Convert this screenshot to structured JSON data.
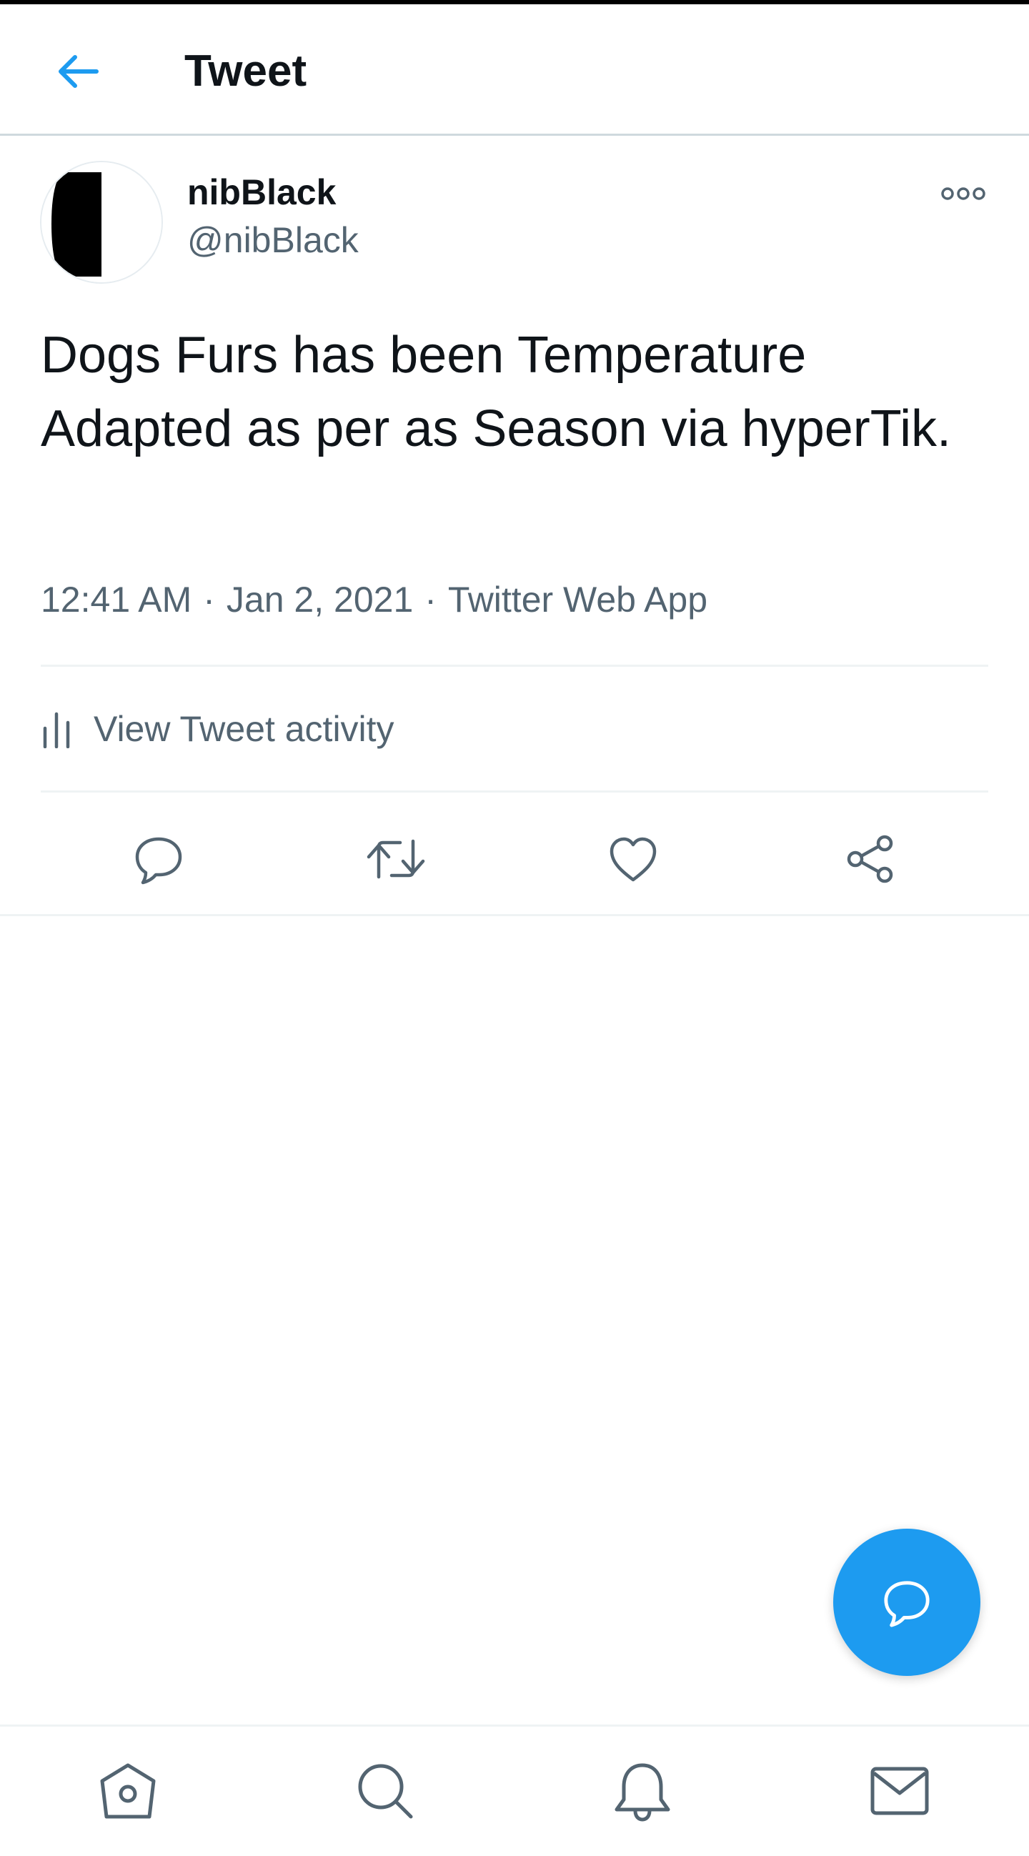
{
  "header": {
    "title": "Tweet",
    "back_icon": "arrow-left-icon",
    "accent_color": "#1d9bf0"
  },
  "tweet": {
    "display_name": "nibBlack",
    "handle": "@nibBlack",
    "text": "Dogs Furs has been Temperature Adapted as per as Season via hyperTik.",
    "time": "12:41 AM",
    "date": "Jan 2, 2021",
    "source": "Twitter Web App",
    "more_icon": "more-horizontal-icon"
  },
  "activity": {
    "label": "View Tweet activity",
    "icon": "bar-chart-icon"
  },
  "actions": [
    {
      "name": "reply",
      "icon": "reply-icon"
    },
    {
      "name": "retweet",
      "icon": "retweet-icon"
    },
    {
      "name": "like",
      "icon": "heart-icon"
    },
    {
      "name": "share",
      "icon": "share-icon"
    }
  ],
  "fab": {
    "icon": "compose-reply-icon",
    "color": "#1d9bf0"
  },
  "bottom_nav": [
    {
      "name": "home",
      "icon": "home-icon"
    },
    {
      "name": "search",
      "icon": "search-icon"
    },
    {
      "name": "notifications",
      "icon": "bell-icon"
    },
    {
      "name": "messages",
      "icon": "mail-icon"
    }
  ],
  "colors": {
    "text_primary": "#0f1419",
    "text_secondary": "#536471",
    "divider": "#eff3f4"
  }
}
